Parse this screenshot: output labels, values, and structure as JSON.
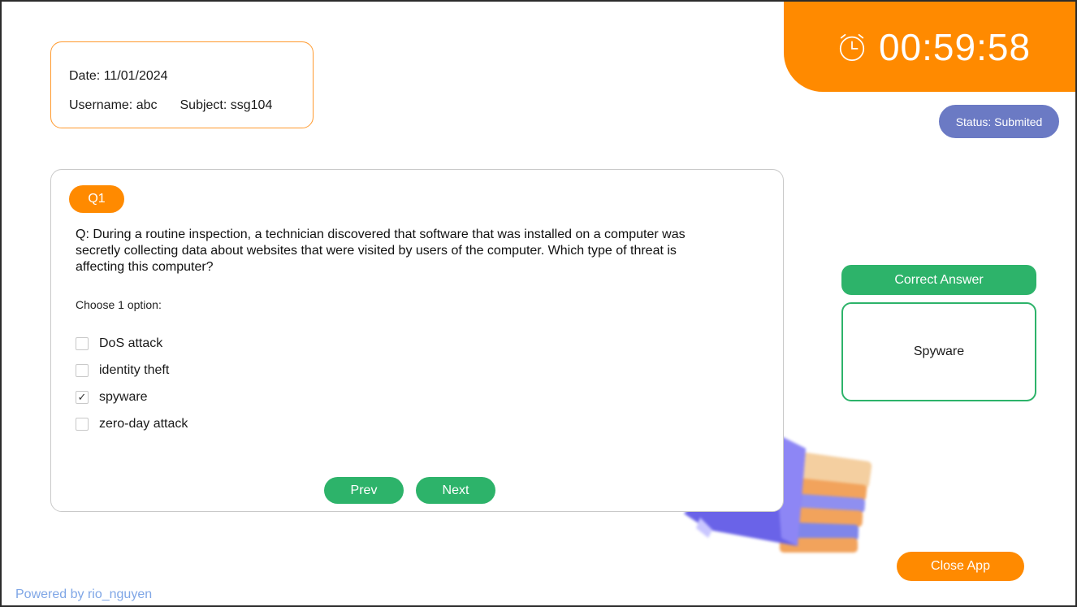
{
  "timer": {
    "time": "00:59:58",
    "icon": "alarm-clock-icon"
  },
  "status": {
    "label": "Status: Submited",
    "color": "#6b7ac4"
  },
  "info": {
    "date": "Date: 11/01/2024",
    "username": "Username: abc",
    "subject": "Subject: ssg104"
  },
  "question": {
    "tag": "Q1",
    "text": "Q: During a routine inspection, a technician discovered that software that was installed on a computer was secretly collecting data about websites that were visited by users of the computer. Which type of threat is affecting this computer?",
    "instruction": "Choose 1 option:",
    "options": [
      {
        "label": "DoS attack",
        "checked": false
      },
      {
        "label": "identity theft",
        "checked": false
      },
      {
        "label": "spyware",
        "checked": true
      },
      {
        "label": "zero-day attack",
        "checked": false
      }
    ],
    "check_mark": "✓"
  },
  "nav": {
    "prev": "Prev",
    "next": "Next"
  },
  "correct_answer": {
    "title": "Correct Answer",
    "value": "Spyware"
  },
  "close_label": "Close App",
  "footer": "Powered by rio_nguyen",
  "colors": {
    "accent": "#ff8a00",
    "success": "#2db36a",
    "status": "#6b7ac4"
  }
}
